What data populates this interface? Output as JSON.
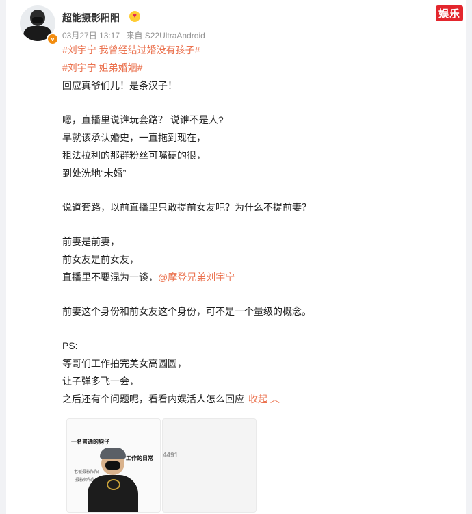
{
  "post": {
    "username": "超能摄影阳阳",
    "username_emoji": "heart-eyes-emoji",
    "date": "03月27日 13:17",
    "source": "来自 S22UltraAndroid",
    "corner_badge": "娱乐",
    "verified_badge": "v"
  },
  "topics": [
    "#刘宇宁 我曾经结过婚没有孩子#",
    "#刘宇宁 姐弟婚姻#"
  ],
  "body": {
    "l1": "回应真爷们儿！是条汉子！",
    "l2": "嗯，直播里说谁玩套路？ 说谁不是人?",
    "l3": "早就该承认婚史，一直拖到现在，",
    "l4": "租法拉利的那群粉丝可嘴硬的很，",
    "l5": "到处洗地“未婚”",
    "l6": "说道套路，以前直播里只敢提前女友吧？为什么不提前妻？",
    "l7": "前妻是前妻，",
    "l8": "前女友是前女友，",
    "l9": "直播里不要混为一谈，",
    "mention": "@摩登兄弟刘宇宁",
    "l10": "前妻这个身份和前女友这个身份，可不是一个量级的概念。",
    "l11": "PS:",
    "l12": "等哥们工作拍完美女高圆圆，",
    "l13": "让子弹多飞一会，",
    "l14": "之后还有个问题呢，看看内娱活人怎么回应",
    "collapse_label": "收起"
  },
  "thumbnails": {
    "t1_cap1": "一名普通的狗仔",
    "t1_cap2": "工作的日常",
    "t1_cap3": "老板摄影阳阳",
    "t1_cap4": "摄影师阳阳",
    "t2_text": "4491"
  }
}
